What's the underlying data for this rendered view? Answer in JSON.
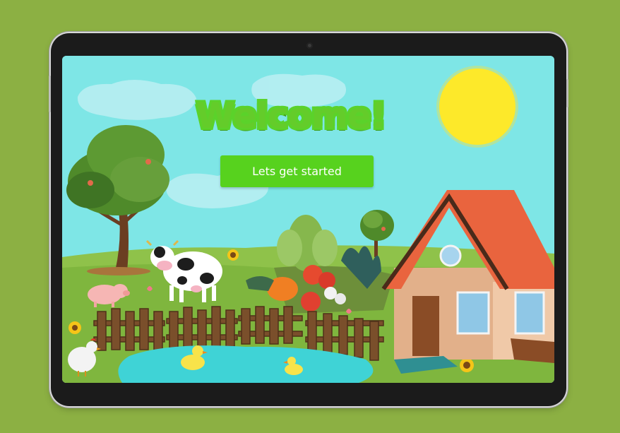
{
  "screen": {
    "title": "Welcome!",
    "start_button_label": "Lets get started"
  },
  "colors": {
    "background": "#8cb043",
    "sky": "#7ee6e6",
    "sun": "#fde92a",
    "accent_green": "#57d21e",
    "roof": "#e9643e",
    "pond": "#3fd3d6"
  }
}
